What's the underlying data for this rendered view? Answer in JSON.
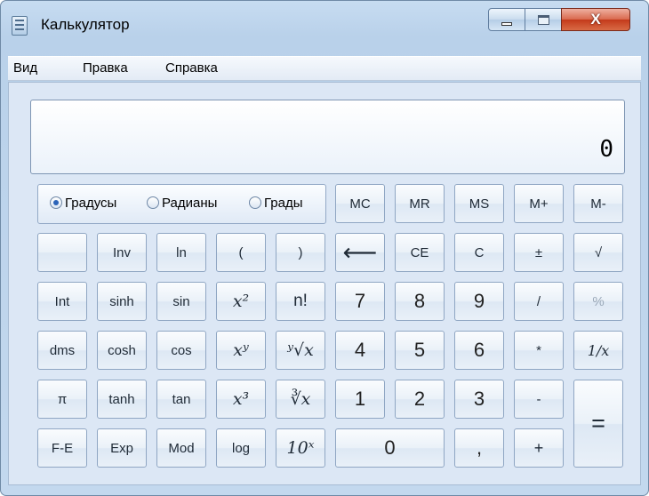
{
  "window": {
    "title": "Калькулятор",
    "close_glyph": "X"
  },
  "menu": [
    "Вид",
    "Правка",
    "Справка"
  ],
  "display": {
    "value": "0"
  },
  "angle_units": [
    {
      "label": "Градусы",
      "selected": true
    },
    {
      "label": "Радианы",
      "selected": false
    },
    {
      "label": "Грады",
      "selected": false
    }
  ],
  "buttons": {
    "mc": "MC",
    "mr": "MR",
    "ms": "MS",
    "mplus": "M+",
    "mminus": "M-",
    "blank": "",
    "inv": "Inv",
    "ln": "ln",
    "lparen": "(",
    "rparen": ")",
    "backspace": "⟵",
    "ce": "CE",
    "c": "C",
    "plusminus": "±",
    "sqrt": "√",
    "int": "Int",
    "sinh": "sinh",
    "sin": "sin",
    "x2": "x²",
    "factorial": "n!",
    "d7": "7",
    "d8": "8",
    "d9": "9",
    "divide": "/",
    "percent": "%",
    "dms": "dms",
    "cosh": "cosh",
    "cos": "cos",
    "xy": "xʸ",
    "yroot": "ʸ√x",
    "d4": "4",
    "d5": "5",
    "d6": "6",
    "multiply": "*",
    "reciprocal": "1/x",
    "pi": "π",
    "tanh": "tanh",
    "tan": "tan",
    "x3": "x³",
    "cuberoot": "∛x",
    "d1": "1",
    "d2": "2",
    "d3": "3",
    "minus": "-",
    "equals": "=",
    "fe": "F-E",
    "exp": "Exp",
    "mod": "Mod",
    "log": "log",
    "tenx": "10ˣ",
    "d0": "0",
    "decimal": ",",
    "plus": "+"
  },
  "colors": {
    "accent": "#2b63b8",
    "close": "#c43a1b",
    "frame": "#c3d8ee"
  }
}
